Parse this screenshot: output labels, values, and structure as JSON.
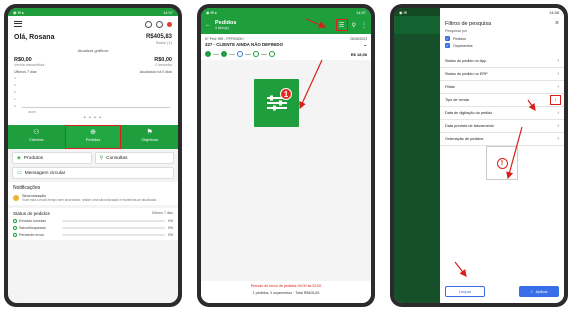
{
  "phone1": {
    "status_time": "14:57",
    "greeting": "Olá, Rosana",
    "balance_value": "R$405,83",
    "balance_label": "Saldo (1)",
    "update_charts": "Atualizar gráficos",
    "left_value": "R$0,00",
    "left_label": "Venda transmitida",
    "right_value": "R$0,00",
    "right_label": "Comissão",
    "period_filter": "Últimos 7 dias",
    "period_right": "Atualizado há 0 dias",
    "y_ticks": [
      "4",
      "3",
      "2",
      "1",
      "0"
    ],
    "x_tick": "26/05",
    "carousel_dots": "• • • •",
    "nav": [
      {
        "label": "Clientes",
        "icon": "clients-icon"
      },
      {
        "label": "Pedidos",
        "icon": "orders-icon"
      },
      {
        "label": "Objetivos",
        "icon": "flag-icon"
      }
    ],
    "menu_cards": {
      "produtos": "Produtos",
      "consultas": "Consultas",
      "mensagem": "Mensagem circular"
    },
    "notifications_title": "Notificações",
    "notification": {
      "title": "Sincronização",
      "text": "Você está a muito tempo sem sincronizar, realize uma sincronização e mantenha-se atualizado."
    },
    "status_title": "Status de pedidos",
    "status_filter": "Últimos 7 dias",
    "status_rows": [
      {
        "name": "Enviado sucesso",
        "pct": "0%"
      },
      {
        "name": "Salvo/bloqueado",
        "pct": "0%"
      },
      {
        "name": "Pendente envio",
        "pct": "0%"
      }
    ]
  },
  "phone2": {
    "status_time": "14:57",
    "title": "Pedidos",
    "subtitle": "4 lidos(s)",
    "order_id": "N° Ped: 999 - PFP00000 /",
    "order_date": "26/05/2023",
    "client": "327 - CLIENTE AINDA NÃO DEFINIDO",
    "order_value": "R$ 18,98",
    "warning": "Período de envio de pedidos 09:00 às 22:00",
    "total": "1 pedidos, 0 orçamentos · Total R$405,83",
    "badge": "1"
  },
  "phone3": {
    "status_time": "14:58",
    "title": "Filtros de pesquisa",
    "search_by": "Pesquisar por",
    "checkboxes": [
      "Pedidos",
      "Orçamentos"
    ],
    "filters": [
      "Status do pedido no App",
      "Status do pedido no ERP",
      "Filiais",
      "Tipo de venda",
      "Data de digitação do pedido",
      "Data prevista de faturamento",
      "Ordenação de pedidos"
    ],
    "clear_label": "Limpar",
    "apply_label": "Aplicar",
    "zoom_icon": "!"
  },
  "colors": {
    "brand_green": "#1f9e3e",
    "accent_blue": "#3a6ee8",
    "highlight_red": "#d8201a"
  }
}
